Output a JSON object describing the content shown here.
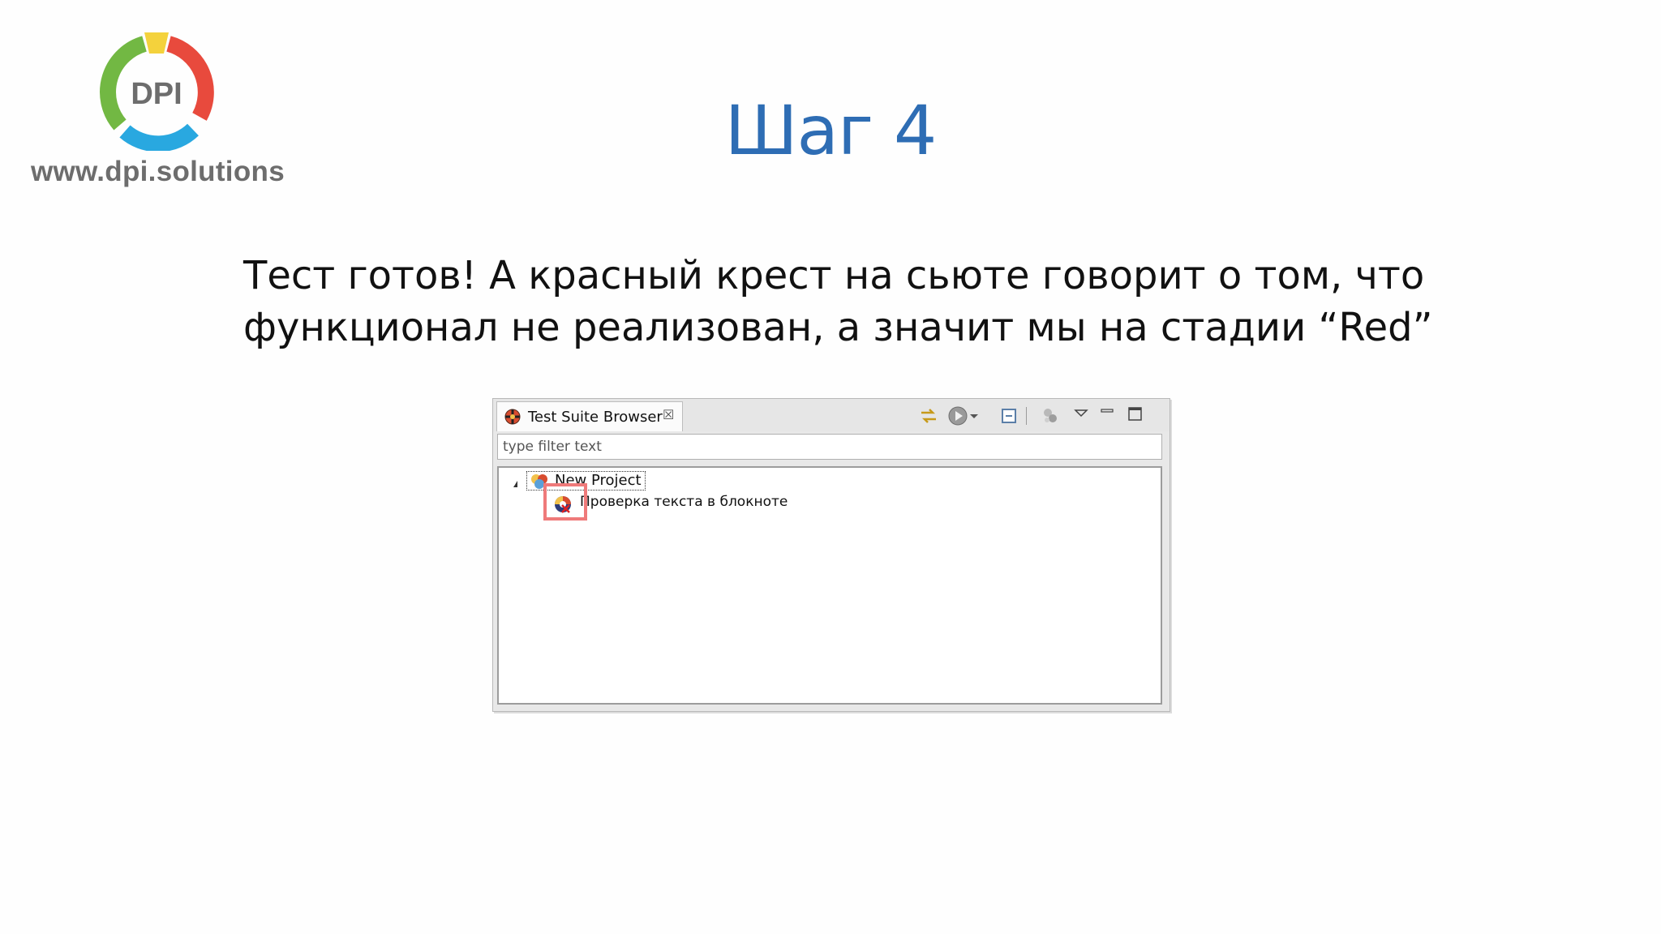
{
  "logo": {
    "letters": "DPI",
    "url": "www.dpi.solutions",
    "colors": {
      "green": "#72b843",
      "red": "#e84a3d",
      "blue": "#29a8e0",
      "yellow": "#f4d23c",
      "text": "#6d6d6d"
    }
  },
  "slide": {
    "title": "Шаг 4",
    "body_lines": [
      "Тест готов! А красный крест на сьюте говорит о том, что",
      "функционал не реализован, а значит мы на стадии “Red”"
    ],
    "title_color": "#2e6db4"
  },
  "panel": {
    "tab_label": "Test Suite Browser",
    "tab_close_glyph": "☒",
    "filter_placeholder": "type filter text",
    "toolbar_icons": [
      "link-with-editor-icon",
      "run-icon",
      "run-dropdown-icon",
      "collapse-all-icon",
      "test-suite-icon",
      "view-menu-icon",
      "minimize-icon",
      "maximize-icon"
    ],
    "tree": {
      "project_label": "New Project",
      "suite_label": "Проверка текста в блокноте",
      "suite_status": "failed",
      "highlight_color": "#ef7a7a"
    }
  }
}
